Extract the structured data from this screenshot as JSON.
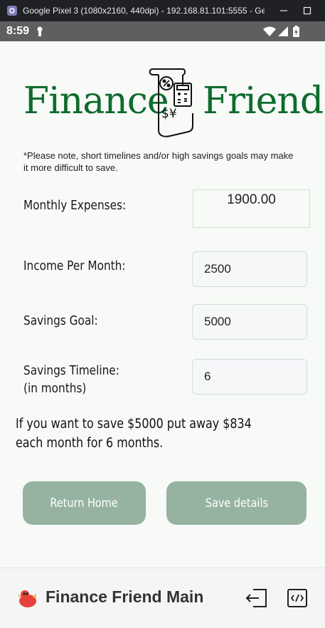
{
  "window": {
    "title": "Google Pixel 3 (1080x2160, 440dpi) - 192.168.81.101:5555 - Ge..."
  },
  "statusbar": {
    "time": "8:59"
  },
  "logo": {
    "word1": "Finance",
    "word2": "Friend"
  },
  "note": "*Please note, short timelines and/or high savings goals may make it more difficult to save.",
  "form": {
    "expenses_label": "Monthly Expenses:",
    "expenses_value": "1900.00",
    "income_label": "Income Per Month:",
    "income_value": "2500",
    "goal_label": "Savings Goal:",
    "goal_value": "5000",
    "timeline_label": "Savings Timeline:",
    "timeline_sub": "(in months)",
    "timeline_value": "6"
  },
  "result": "If you want to save $5000 put away $834 each month for 6 months.",
  "buttons": {
    "return_home": "Return Home",
    "save_details": "Save details"
  },
  "bottombar": {
    "title": "Finance Friend Main"
  },
  "colors": {
    "brand_green": "#0f6b2e",
    "button_bg": "#95b3a0",
    "app_bg": "#f7faf6"
  }
}
